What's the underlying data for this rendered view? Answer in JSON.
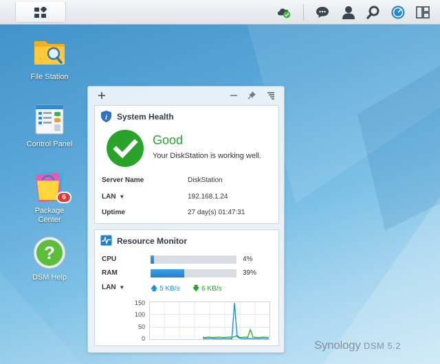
{
  "taskbar": {
    "icons": [
      "main-menu-icon",
      "cloud-status-icon",
      "notifications-icon",
      "user-icon",
      "search-icon",
      "widgets-icon",
      "window-layout-icon"
    ]
  },
  "desktop": {
    "icons": [
      {
        "label": "File Station",
        "icon": "file-station-icon"
      },
      {
        "label": "Control Panel",
        "icon": "control-panel-icon"
      },
      {
        "label": "Package\nCenter",
        "label_line1": "Package",
        "label_line2": "Center",
        "icon": "package-center-icon",
        "badge": "6"
      },
      {
        "label": "DSM Help",
        "icon": "help-icon"
      }
    ]
  },
  "widget_panel": {
    "controls": [
      "add-widget-icon",
      "minimize-icon",
      "pin-icon",
      "settings-icon"
    ]
  },
  "system_health": {
    "title": "System Health",
    "status": "Good",
    "message": "Your DiskStation is working well.",
    "rows": [
      {
        "label": "Server Name",
        "value": "DiskStation"
      },
      {
        "label": "LAN",
        "value": "192.168.1.24"
      },
      {
        "label": "Uptime",
        "value": "27 day(s) 01:47:31"
      }
    ],
    "status_color": "#2aa32a"
  },
  "resource_monitor": {
    "title": "Resource Monitor",
    "cpu": {
      "label": "CPU",
      "value": "4%",
      "percent": 4
    },
    "ram": {
      "label": "RAM",
      "value": "39%",
      "percent": 39
    },
    "lan": {
      "label": "LAN",
      "upload": "5 KB/s",
      "download": "6 KB/s"
    },
    "chart": {
      "ticks": [
        "150",
        "100",
        "50",
        "0"
      ],
      "ymax": 150,
      "upload_series": [
        3,
        2,
        3,
        4,
        2,
        3,
        2,
        2,
        3,
        2,
        3,
        2,
        150,
        10,
        4,
        3,
        2,
        4,
        3,
        2,
        3,
        2,
        3,
        4,
        2,
        3
      ],
      "download_series": [
        8,
        7,
        9,
        8,
        7,
        8,
        9,
        8,
        7,
        8,
        9,
        8,
        10,
        16,
        7,
        8,
        9,
        8,
        40,
        9,
        8,
        7,
        8,
        9,
        8,
        7
      ],
      "upload_color": "#1a8ee0",
      "download_color": "#2ab52a"
    }
  },
  "watermark": {
    "brand": "Synology",
    "product": "DSM 5.2"
  }
}
